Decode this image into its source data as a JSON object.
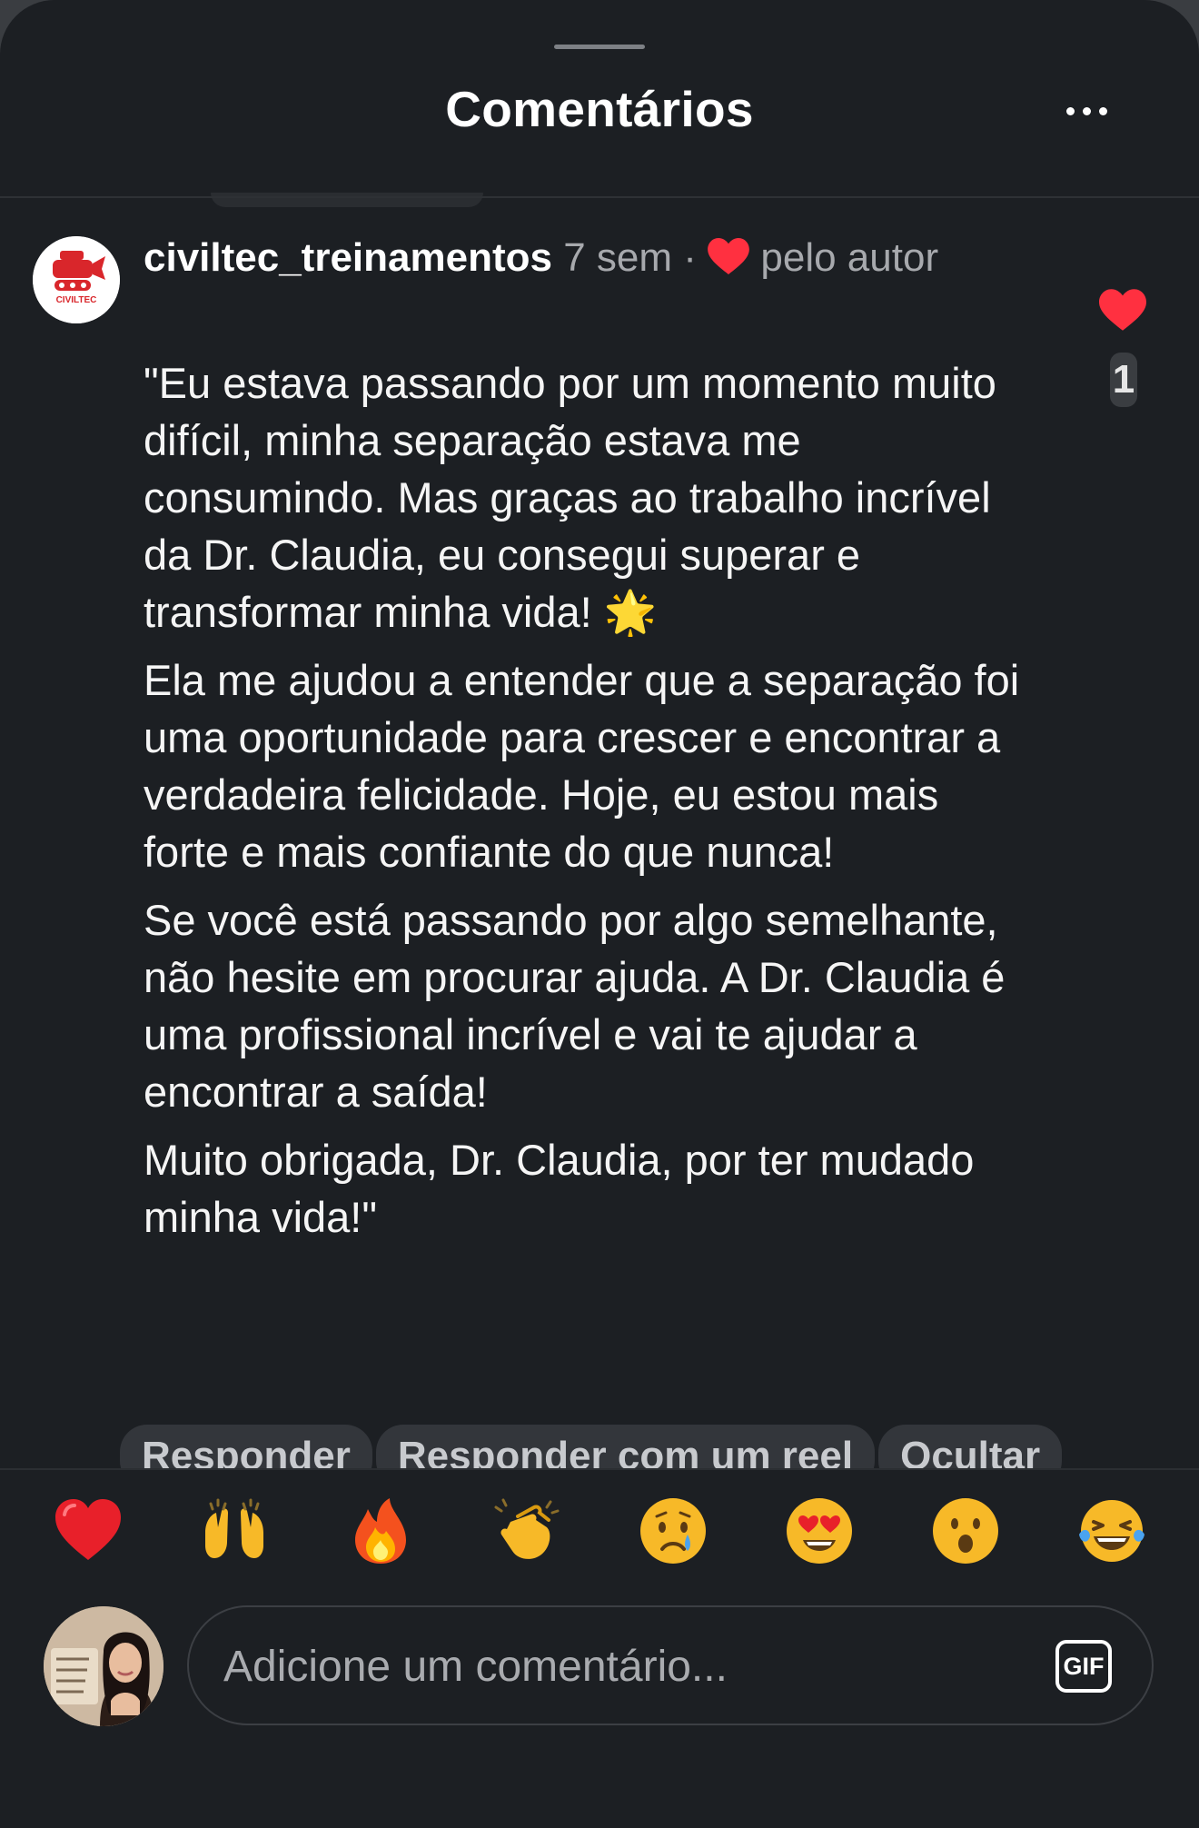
{
  "header": {
    "title": "Comentários"
  },
  "comment": {
    "username": "civiltec_treinamentos",
    "time": "7 sem",
    "separator": "·",
    "liked_by": "pelo autor",
    "avatar_text": "CIVILTEC",
    "paragraphs": [
      "\"Eu estava passando por um momento muito difícil, minha separação estava me consumindo. Mas graças ao trabalho incrível da Dr. Claudia, eu consegui superar e transformar minha vida! 🌟",
      "Ela me ajudou a entender que a separação foi uma oportunidade para crescer e encontrar a verdadeira felicidade. Hoje, eu estou mais forte e mais confiante do que nunca!",
      "Se você está passando por algo semelhante, não hesite em procurar ajuda. A Dr. Claudia é uma profissional incrível e vai te ajudar a encontrar a saída!",
      "Muito obrigada, Dr. Claudia, por ter mudado minha vida!\""
    ],
    "like_count": "1"
  },
  "actions": {
    "reply": "Responder",
    "reply_reel": "Responder com um reel",
    "hide": "Ocultar"
  },
  "emoji_bar": [
    "❤️",
    "🙌",
    "🔥",
    "👏",
    "😢",
    "😍",
    "😮",
    "😂"
  ],
  "composer": {
    "placeholder": "Adicione um comentário...",
    "gif_label": "GIF"
  },
  "colors": {
    "background": "#1c1f23",
    "heart": "#ff3040",
    "text": "#f5f5f5",
    "muted": "#a7a9ad"
  }
}
